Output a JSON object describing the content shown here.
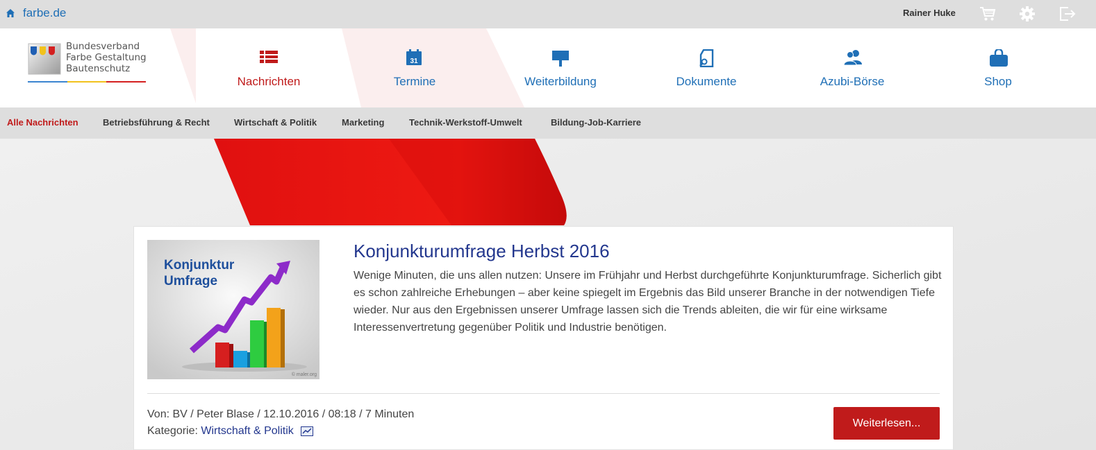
{
  "topbar": {
    "site": "farbe.de",
    "user": "Rainer Huke"
  },
  "logo": {
    "line1": "Bundesverband",
    "line2": "Farbe Gestaltung",
    "line3": "Bautenschutz"
  },
  "nav": [
    {
      "label": "Nachrichten",
      "icon": "news-list-icon",
      "active": true
    },
    {
      "label": "Termine",
      "icon": "calendar-icon",
      "calendar_day": "31"
    },
    {
      "label": "Weiterbildung",
      "icon": "presentation-board-icon"
    },
    {
      "label": "Dokumente",
      "icon": "document-search-icon"
    },
    {
      "label": "Azubi-Börse",
      "icon": "users-icon"
    },
    {
      "label": "Shop",
      "icon": "shopping-bag-icon"
    }
  ],
  "subnav": [
    {
      "label": "Alle Nachrichten",
      "active": true
    },
    {
      "label": "Betriebsführung & Recht"
    },
    {
      "label": "Wirtschaft & Politik"
    },
    {
      "label": "Marketing"
    },
    {
      "label": "Technik-Werkstoff-Umwelt"
    },
    {
      "label": "Bildung-Job-Karriere"
    }
  ],
  "article": {
    "thumb_line1": "Konjunktur",
    "thumb_line2": "Umfrage",
    "thumb_copyright": "© maler.org",
    "title": "Konjunkturumfrage Herbst 2016",
    "text": "Wenige Minuten, die uns allen nutzen: Unsere im Frühjahr und Herbst durchgeführte Konjunkturumfrage. Sicherlich gibt es schon zahlreiche Erhebungen – aber keine spiegelt im Ergebnis das Bild unserer Branche in der notwendigen Tiefe wieder. Nur aus den Ergebnissen unserer Umfrage lassen sich die Trends ableiten, die wir für eine wirksame Interessenvertretung gegenüber Politik und Industrie benötigen.",
    "meta": "Von:  BV / Peter Blase / 12.10.2016 / 08:18 / 7 Minuten",
    "category_label": "Kategorie: ",
    "category": "Wirtschaft & Politik",
    "button": "Weiterlesen..."
  },
  "colors": {
    "brand_red": "#c01b1b",
    "link_blue": "#1f6fb6",
    "title_blue": "#23378e"
  }
}
